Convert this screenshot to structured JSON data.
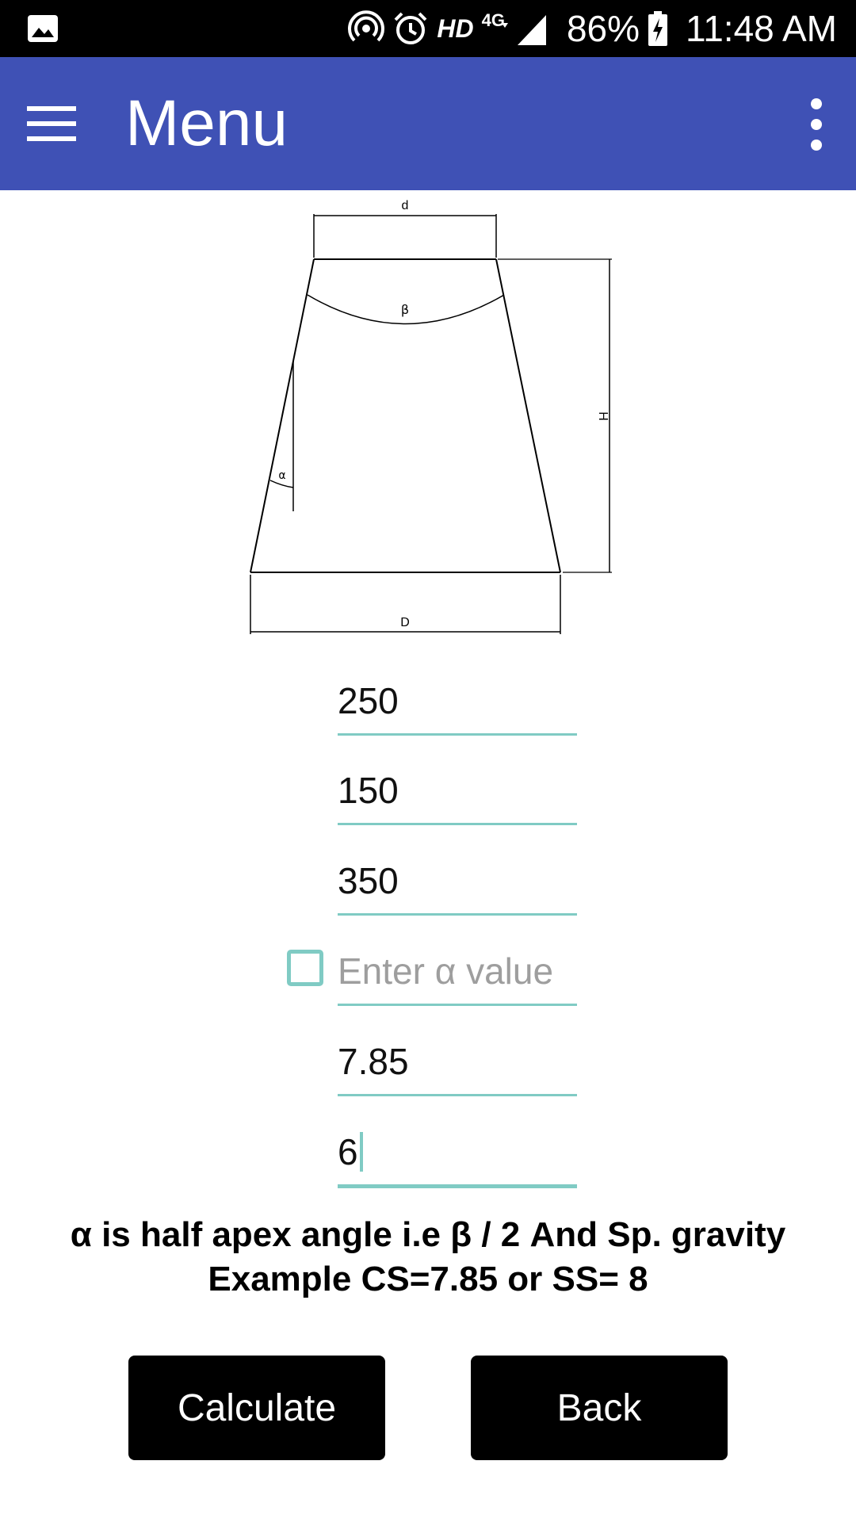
{
  "status_bar": {
    "hd_label": "HD",
    "network_label": "4G",
    "battery_percent": "86%",
    "time": "11:48 AM",
    "icons": [
      "image-icon",
      "hotspot-icon",
      "alarm-icon",
      "signal-icon",
      "battery-charging-icon"
    ]
  },
  "app_bar": {
    "title": "Menu",
    "color": "#3F51B5"
  },
  "diagram": {
    "labels": {
      "top_diameter": "d",
      "bottom_diameter": "D",
      "height": "H",
      "apex_angle": "β",
      "half_angle": "α"
    }
  },
  "fields": [
    {
      "value": "250"
    },
    {
      "value": "150"
    },
    {
      "value": "350"
    },
    {
      "value": "",
      "placeholder": "Enter α value",
      "checkbox_checked": false
    },
    {
      "value": "7.85"
    },
    {
      "value": "6",
      "focused": true
    }
  ],
  "note": "α is half apex angle i.e β / 2 And Sp. gravity Example CS=7.85 or SS= 8",
  "buttons": {
    "calculate": "Calculate",
    "back": "Back"
  },
  "accent_color": "#80CBC4"
}
